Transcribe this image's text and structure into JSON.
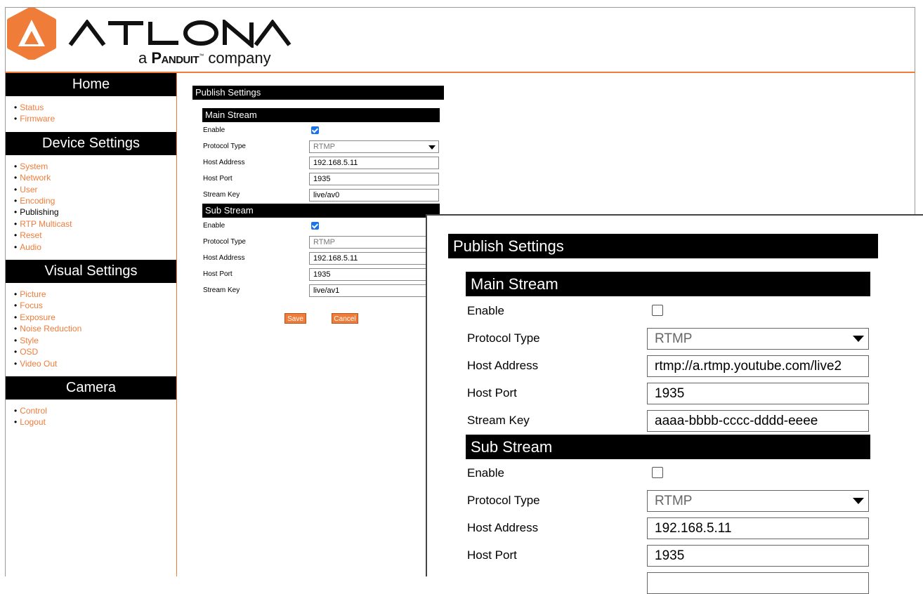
{
  "brand": {
    "name": "ATLONA",
    "tagline_prefix": "a",
    "tagline_brand": "Panduit",
    "tagline_suffix": "company",
    "accent": "#f07c3a"
  },
  "sidebar": {
    "sections": [
      {
        "title": "Home",
        "items": [
          "Status",
          "Firmware"
        ]
      },
      {
        "title": "Device Settings",
        "items": [
          "System",
          "Network",
          "User",
          "Encoding",
          "Publishing",
          "RTP Multicast",
          "Reset",
          "Audio"
        ]
      },
      {
        "title": "Visual Settings",
        "items": [
          "Picture",
          "Focus",
          "Exposure",
          "Noise Reduction",
          "Style",
          "OSD",
          "Video Out"
        ]
      },
      {
        "title": "Camera",
        "items": [
          "Control",
          "Logout"
        ]
      }
    ],
    "active_item": "Publishing"
  },
  "form": {
    "title": "Publish Settings",
    "main_stream": {
      "heading": "Main Stream",
      "labels": {
        "enable": "Enable",
        "protocol": "Protocol Type",
        "host": "Host Address",
        "port": "Host Port",
        "key": "Stream Key"
      },
      "enable": true,
      "protocol": "RTMP",
      "host": "192.168.5.11",
      "port": "1935",
      "key": "live/av0"
    },
    "sub_stream": {
      "heading": "Sub Stream",
      "labels": {
        "enable": "Enable",
        "protocol": "Protocol Type",
        "host": "Host Address",
        "port": "Host Port",
        "key": "Stream Key"
      },
      "enable": true,
      "protocol": "RTMP",
      "host": "192.168.5.11",
      "port": "1935",
      "key": "live/av1"
    },
    "save_label": "Save",
    "cancel_label": "Cancel"
  },
  "zoom": {
    "title": "Publish Settings",
    "main_stream": {
      "heading": "Main Stream",
      "labels": {
        "enable": "Enable",
        "protocol": "Protocol Type",
        "host": "Host Address",
        "port": "Host Port",
        "key": "Stream Key"
      },
      "enable": false,
      "protocol": "RTMP",
      "host": "rtmp://a.rtmp.youtube.com/live2",
      "port": "1935",
      "key": "aaaa-bbbb-cccc-dddd-eeee"
    },
    "sub_stream": {
      "heading": "Sub Stream",
      "labels": {
        "enable": "Enable",
        "protocol": "Protocol Type",
        "host": "Host Address",
        "port": "Host Port"
      },
      "enable": false,
      "protocol": "RTMP",
      "host": "192.168.5.11",
      "port": "1935"
    }
  }
}
